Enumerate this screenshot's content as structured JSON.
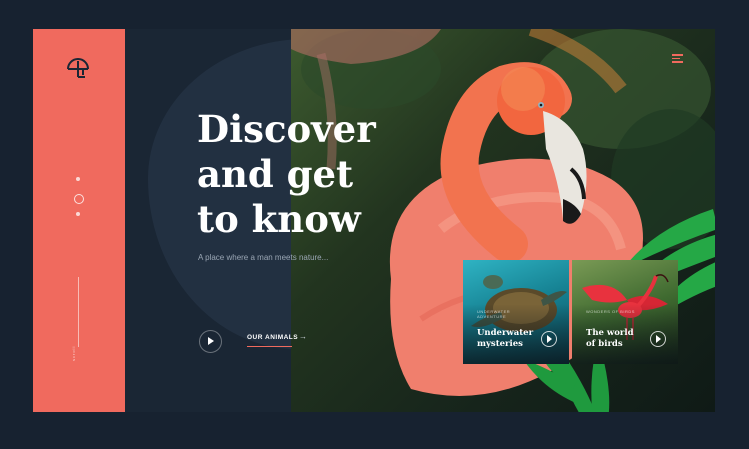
{
  "hero": {
    "headline_lines": [
      "Discover",
      "and get",
      "to know"
    ],
    "tagline": "A place where a man meets nature...",
    "cta_label": "OUR ANIMALS",
    "cta_arrow": "→"
  },
  "sidebar": {
    "vertical_label": "scroll",
    "accent_color": "#f06a5e"
  },
  "cards": [
    {
      "eyebrow": "UNDERWATER ADVENTURE",
      "title_lines": [
        "Underwater",
        "mysteries"
      ]
    },
    {
      "eyebrow": "WONDERS OF BIRDS",
      "title_lines": [
        "The world",
        "of birds"
      ]
    }
  ],
  "icons": {
    "logo": "zoo-logo-icon",
    "menu": "hamburger-menu-icon",
    "play": "play-icon",
    "card_arrow": "chevron-right-icon"
  }
}
